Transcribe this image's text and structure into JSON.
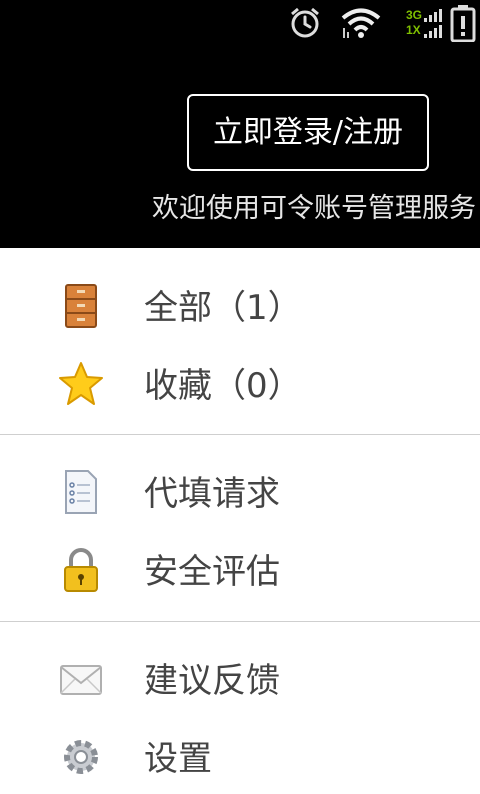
{
  "login_button": "立即登录/注册",
  "welcome_text": "欢迎使用可令账号管理服务",
  "status": {
    "network_top": "3G",
    "network_bottom": "1X"
  },
  "menu": {
    "all": "全部（1）",
    "favorites": "收藏（0）",
    "autofill": "代填请求",
    "security": "安全评估",
    "feedback": "建议反馈",
    "settings": "设置"
  },
  "icons": [
    "alarm-icon",
    "wifi-icon",
    "signal-icon",
    "battery-icon",
    "cabinet-icon",
    "star-icon",
    "document-icon",
    "lock-icon",
    "mail-icon",
    "gear-icon"
  ],
  "colors": {
    "header_bg": "#000000",
    "network_label": "#7fbf00",
    "menu_text": "#444444"
  }
}
